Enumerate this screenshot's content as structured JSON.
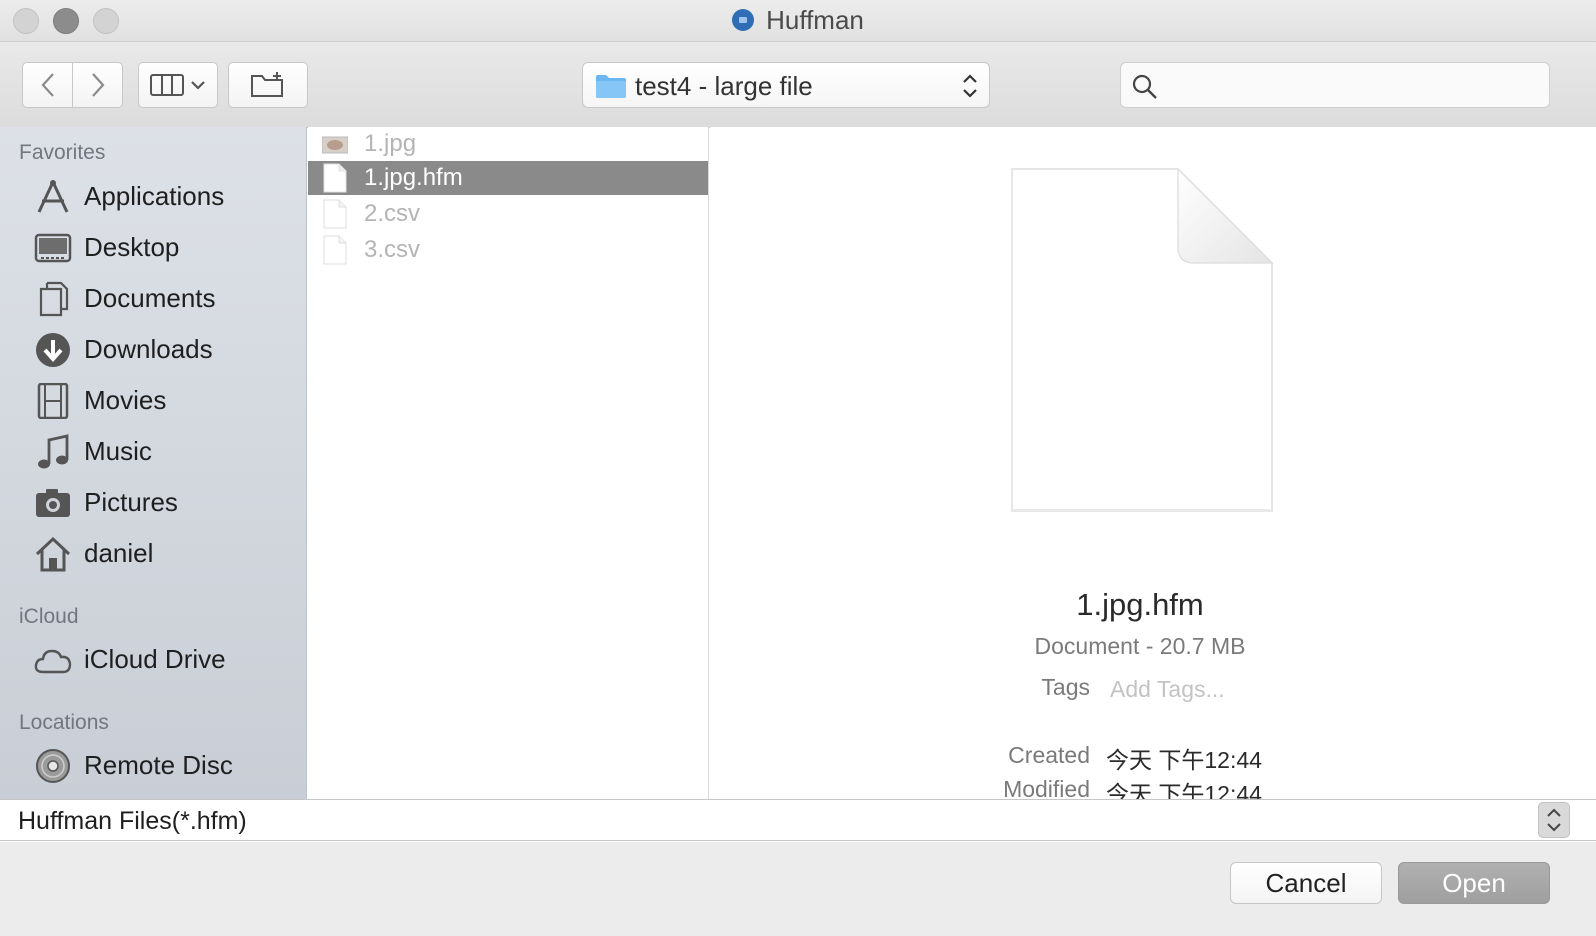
{
  "window": {
    "title": "Huffman"
  },
  "toolbar": {
    "path_label": "test4 - large file",
    "search_placeholder": ""
  },
  "sidebar": {
    "sections": [
      {
        "heading": "Favorites",
        "items": [
          {
            "label": "Applications",
            "icon": "applications-icon"
          },
          {
            "label": "Desktop",
            "icon": "desktop-icon"
          },
          {
            "label": "Documents",
            "icon": "documents-icon"
          },
          {
            "label": "Downloads",
            "icon": "downloads-icon"
          },
          {
            "label": "Movies",
            "icon": "movies-icon"
          },
          {
            "label": "Music",
            "icon": "music-icon"
          },
          {
            "label": "Pictures",
            "icon": "pictures-icon"
          },
          {
            "label": "daniel",
            "icon": "home-icon"
          }
        ]
      },
      {
        "heading": "iCloud",
        "items": [
          {
            "label": "iCloud Drive",
            "icon": "cloud-icon"
          }
        ]
      },
      {
        "heading": "Locations",
        "items": [
          {
            "label": "Remote Disc",
            "icon": "disc-icon"
          }
        ]
      }
    ]
  },
  "files": [
    {
      "name": "1.jpg",
      "enabled": false,
      "selected": false,
      "icon": "image-thumbnail-icon"
    },
    {
      "name": "1.jpg.hfm",
      "enabled": true,
      "selected": true,
      "icon": "document-icon"
    },
    {
      "name": "2.csv",
      "enabled": false,
      "selected": false,
      "icon": "document-icon"
    },
    {
      "name": "3.csv",
      "enabled": false,
      "selected": false,
      "icon": "document-icon"
    }
  ],
  "preview": {
    "name": "1.jpg.hfm",
    "kind": "Document - 20.7 MB",
    "tags_label": "Tags",
    "tags_placeholder": "Add Tags...",
    "created_label": "Created",
    "created_value": "今天 下午12:44",
    "modified_label": "Modified",
    "modified_value": "今天 下午12:44"
  },
  "filter": {
    "value": "Huffman Files(*.hfm)"
  },
  "buttons": {
    "cancel": "Cancel",
    "open": "Open"
  },
  "colors": {
    "selection": "#8a8a8a",
    "sidebar_top": "#dde1e7",
    "open_button": "#a6a6a6"
  }
}
